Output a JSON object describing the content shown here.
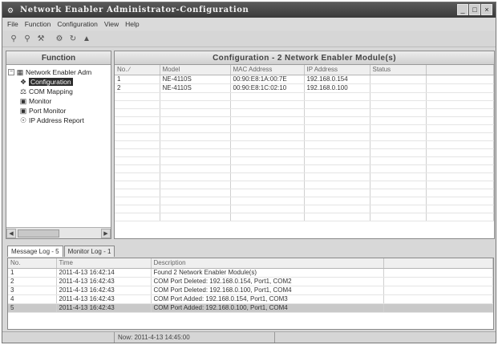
{
  "window": {
    "title": "Network Enabler Administrator-Configuration",
    "controls": [
      "_",
      "□",
      "×"
    ]
  },
  "menu": [
    "File",
    "Function",
    "Configuration",
    "View",
    "Help"
  ],
  "toolbar": [
    "search-icon",
    "search-icon",
    "tool-icon",
    "settings-icon",
    "refresh-icon",
    "lock-icon"
  ],
  "function_panel": {
    "title": "Function",
    "tree": [
      {
        "label": "Network Enabler Adm",
        "icon": "network-icon",
        "level": 0
      },
      {
        "label": "Configuration",
        "icon": "config-icon",
        "level": 1,
        "selected": true
      },
      {
        "label": "COM Mapping",
        "icon": "mapping-icon",
        "level": 1
      },
      {
        "label": "Monitor",
        "icon": "monitor-icon",
        "level": 1
      },
      {
        "label": "Port Monitor",
        "icon": "monitor-icon",
        "level": 1
      },
      {
        "label": "IP Address Report",
        "icon": "report-icon",
        "level": 1
      }
    ]
  },
  "config_panel": {
    "title": "Configuration - 2 Network Enabler Module(s)",
    "columns": [
      "No. ∕",
      "Model",
      "MAC Address",
      "IP Address",
      "Status"
    ],
    "rows": [
      [
        "1",
        "NE-4110S",
        "00:90:E8:1A:00:7E",
        "192.168.0.154",
        ""
      ],
      [
        "2",
        "NE-4110S",
        "00:90:E8:1C:02:10",
        "192.168.0.100",
        ""
      ]
    ]
  },
  "tabs": [
    "Message Log - 5",
    "Monitor Log - 1"
  ],
  "log": {
    "columns": [
      "No.",
      "Time",
      "Description"
    ],
    "rows": [
      [
        "1",
        "2011-4-13 16:42:14",
        "Found 2 Network Enabler Module(s)"
      ],
      [
        "2",
        "2011-4-13 16:42:43",
        "COM Port Deleted: 192.168.0.154, Port1, COM2"
      ],
      [
        "3",
        "2011-4-13 16:42:43",
        "COM Port Deleted: 192.168.0.100, Port1, COM4"
      ],
      [
        "4",
        "2011-4-13 16:42:43",
        "COM Port Added: 192.168.0.154, Port1, COM3"
      ],
      [
        "5",
        "2011-4-13 16:42:43",
        "COM Port Added: 192.168.0.100, Port1, COM4"
      ]
    ]
  },
  "status": {
    "time": "Now: 2011-4-13 14:45:00"
  }
}
